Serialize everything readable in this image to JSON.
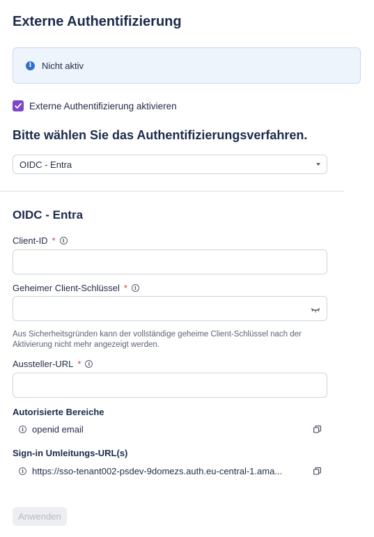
{
  "page": {
    "title": "Externe Authentifizierung"
  },
  "status": {
    "icon": "info-icon",
    "text": "Nicht aktiv",
    "accent": "#2f6fd1"
  },
  "enable_checkbox": {
    "checked": true,
    "label": "Externe Authentifizierung aktivieren",
    "color": "#7b46c8"
  },
  "method": {
    "heading": "Bitte wählen Sie das Authentifizierungsverfahren.",
    "selected": "OIDC - Entra"
  },
  "provider": {
    "heading": "OIDC - Entra",
    "client_id": {
      "label": "Client-ID",
      "required_mark": "*",
      "value": ""
    },
    "client_secret": {
      "label": "Geheimer Client-Schlüssel",
      "required_mark": "*",
      "value": "",
      "helper": "Aus Sicherheitsgründen kann der vollständige geheime Client-Schlüssel nach der Aktivierung nicht mehr angezeigt werden."
    },
    "issuer_url": {
      "label": "Aussteller-URL",
      "required_mark": "*",
      "value": ""
    },
    "scopes": {
      "label": "Autorisierte Bereiche",
      "value": "openid email"
    },
    "redirect": {
      "label": "Sign-in Umleitungs-URL(s)",
      "value": "https://sso-tenant002-psdev-9domezs.auth.eu-central-1.ama..."
    }
  },
  "actions": {
    "apply_label": "Anwenden",
    "apply_enabled": false
  }
}
